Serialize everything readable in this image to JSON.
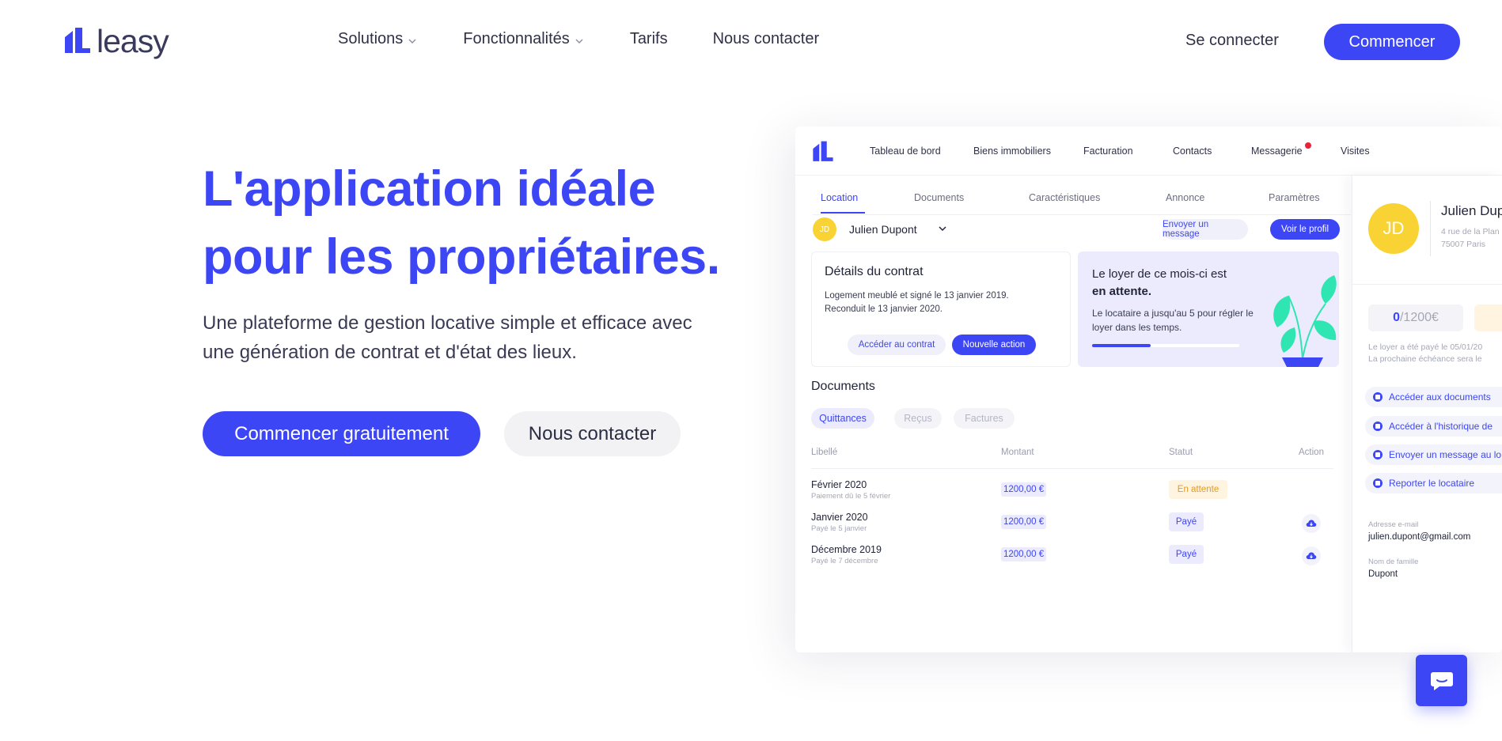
{
  "header": {
    "logo_text": "leasy",
    "nav": [
      {
        "label": "Solutions",
        "has_dropdown": true
      },
      {
        "label": "Fonctionnalités",
        "has_dropdown": true
      },
      {
        "label": "Tarifs",
        "has_dropdown": false
      },
      {
        "label": "Nous contacter",
        "has_dropdown": false
      }
    ],
    "login_label": "Se connecter",
    "cta_label": "Commencer"
  },
  "hero": {
    "title_line1": "L'application idéale",
    "title_line2": "pour les propriétaires.",
    "subtitle_line1": "Une plateforme de gestion locative simple et efficace avec",
    "subtitle_line2": "une génération de contrat et d'état des lieux.",
    "primary_button": "Commencer gratuitement",
    "secondary_button": "Nous contacter"
  },
  "mockup": {
    "nav": [
      "Tableau de bord",
      "Biens immobiliers",
      "Facturation",
      "Contacts",
      "Messagerie",
      "Visites"
    ],
    "tabs": [
      "Location",
      "Documents",
      "Caractéristiques",
      "Annonce",
      "Paramètres"
    ],
    "tenant": {
      "initials": "JD",
      "name": "Julien Dupont",
      "send_message": "Envoyer un message",
      "view_profile": "Voir le profil"
    },
    "contract_card": {
      "title": "Détails du contrat",
      "line1": "Logement meublé et signé le 13 janvier 2019.",
      "line2": "Reconduit le 13 janvier 2020.",
      "btn_access": "Accéder au contrat",
      "btn_action": "Nouvelle action"
    },
    "rent_card": {
      "title_line1": "Le loyer de ce mois-ci est",
      "title_line2": "en attente.",
      "text_line1": "Le locataire a jusqu'au 5 pour régler le",
      "text_line2": "loyer dans les temps.",
      "progress": 0.4
    },
    "documents": {
      "title": "Documents",
      "chips": [
        "Quittances",
        "Reçus",
        "Factures"
      ],
      "columns": [
        "Libellé",
        "Montant",
        "Statut",
        "Action"
      ],
      "rows": [
        {
          "label": "Février 2020",
          "sub": "Paiement dû le 5 février",
          "amount": "1200,00 €",
          "status": "En attente"
        },
        {
          "label": "Janvier 2020",
          "sub": "Payé le 5 janvier",
          "amount": "1200,00 €",
          "status": "Payé"
        },
        {
          "label": "Décembre 2019",
          "sub": "Payé le 7 décembre",
          "amount": "1200,00 €",
          "status": "Payé"
        }
      ]
    },
    "profile": {
      "initials": "JD",
      "name": "Julien Dupo",
      "address_line1": "4 rue de la Plan",
      "address_line2": "75007 Paris",
      "paid_value": "0",
      "paid_total": "/1200€",
      "note_line1": "Le loyer a été payé le 05/01/20",
      "note_line2": "La prochaine échéance sera le",
      "links": [
        "Accéder aux documents",
        "Accéder à l'historique de",
        "Envoyer un message au lo",
        "Reporter le locataire"
      ],
      "email_label": "Adresse e-mail",
      "email_value": "julien.dupont@gmail.com",
      "lastname_label": "Nom de famille",
      "lastname_value": "Dupont"
    }
  },
  "colors": {
    "accent": "#3d46f5",
    "avatar": "#f8d333",
    "pending": "#e39a1f",
    "plant": "#2fe6b3"
  }
}
